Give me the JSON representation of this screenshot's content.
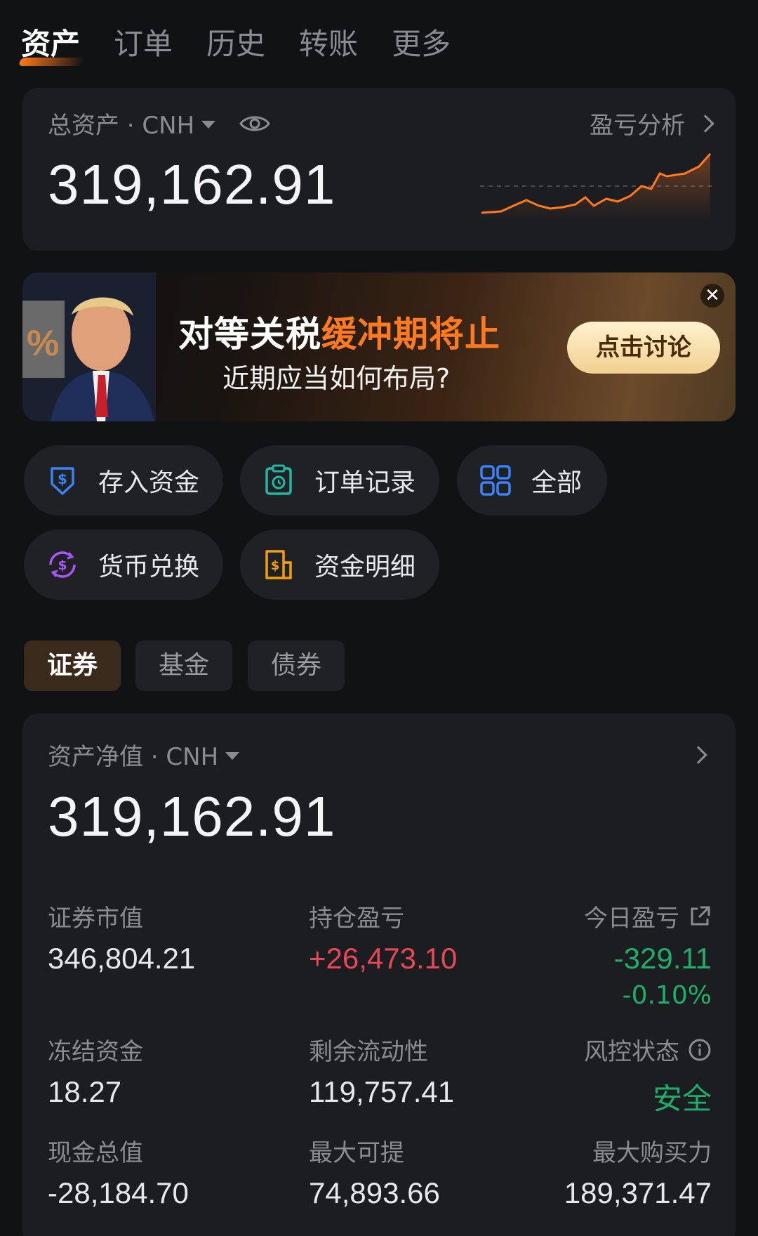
{
  "top_tabs": [
    "资产",
    "订单",
    "历史",
    "转账",
    "更多"
  ],
  "total": {
    "label": "总资产 · CNH",
    "analysis": "盈亏分析",
    "value": "319,162.91"
  },
  "banner": {
    "title_white": "对等关税",
    "title_orange": "缓冲期将止",
    "subtitle": "近期应当如何布局?",
    "button": "点击讨论",
    "close": "✕"
  },
  "shortcuts": {
    "deposit": "存入资金",
    "orders": "订单记录",
    "all": "全部",
    "exchange": "货币兑换",
    "details": "资金明细"
  },
  "segments": [
    "证券",
    "基金",
    "债券"
  ],
  "net": {
    "label": "资产净值 · CNH",
    "value": "319,162.91",
    "metrics": {
      "market_value_label": "证券市值",
      "market_value": "346,804.21",
      "position_pl_label": "持仓盈亏",
      "position_pl": "+26,473.10",
      "today_pl_label": "今日盈亏",
      "today_pl": "-329.11",
      "today_pl_pct": "-0.10%",
      "frozen_label": "冻结资金",
      "frozen": "18.27",
      "liquidity_label": "剩余流动性",
      "liquidity": "119,757.41",
      "risk_label": "风控状态",
      "risk": "安全",
      "cash_label": "现金总值",
      "cash": "-28,184.70",
      "max_withdraw_label": "最大可提",
      "max_withdraw": "74,893.66",
      "buying_power_label": "最大购买力",
      "buying_power": "189,371.47"
    }
  },
  "colors": {
    "accent": "#ff7a21",
    "up": "#e64858",
    "down": "#1fae6a",
    "card": "#1c1d21",
    "bg": "#111214"
  }
}
